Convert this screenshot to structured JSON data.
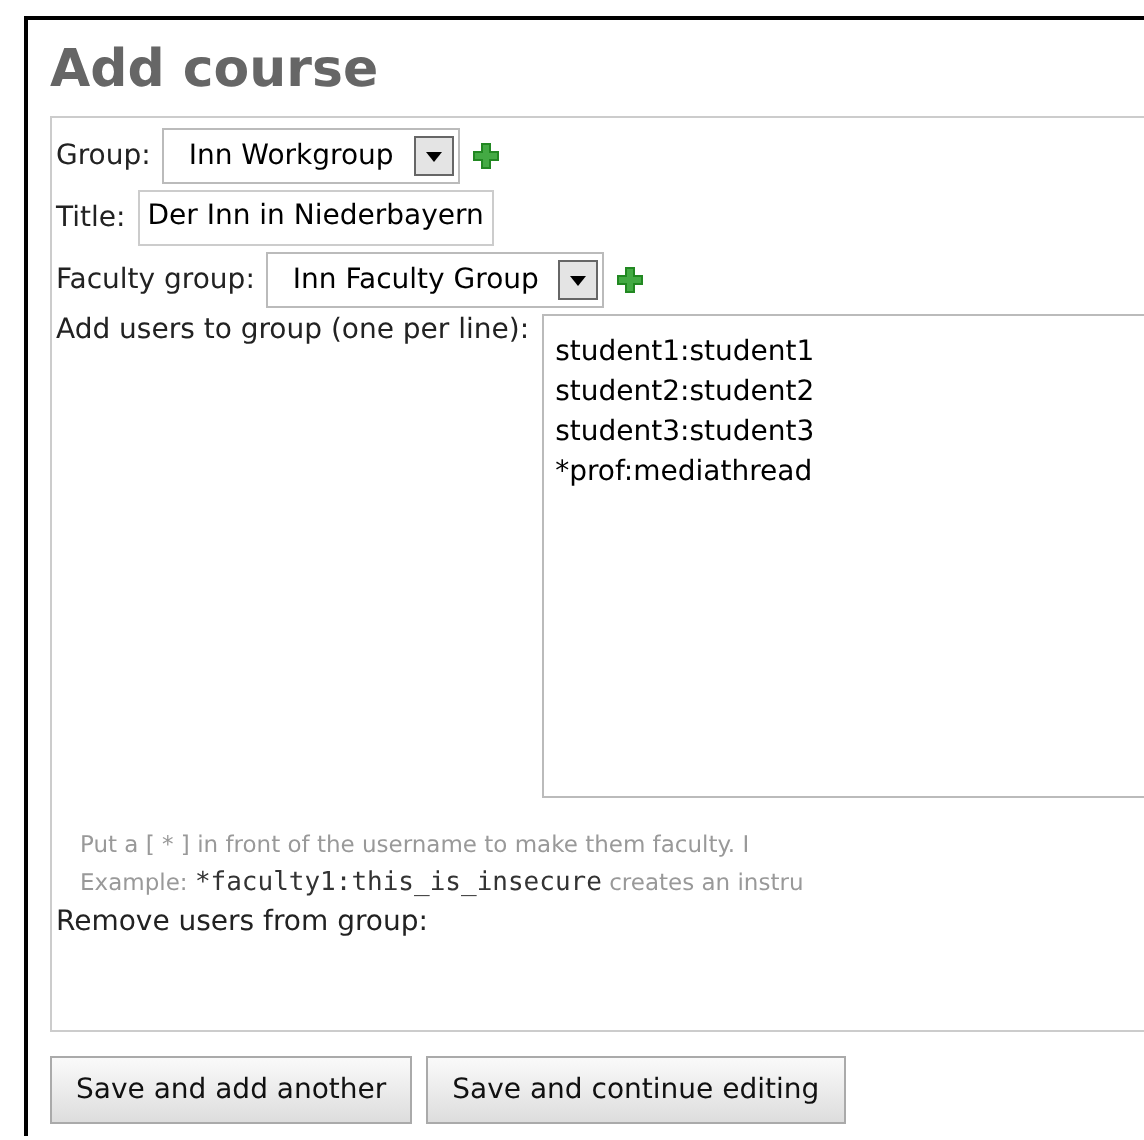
{
  "heading": "Add course",
  "fields": [
    {
      "kind": "select",
      "label": "Group:",
      "value": "Inn Workgroup",
      "add": true
    },
    {
      "kind": "text",
      "label": "Title:",
      "value": "Der Inn in Niederbayern"
    },
    {
      "kind": "select",
      "label": "Faculty group:",
      "value": "Inn Faculty Group",
      "add": true
    }
  ],
  "add_users": {
    "label": "Add users to group (one per line):",
    "lines": [
      "student1:student1",
      "student2:student2",
      "student3:student3",
      "*prof:mediathread"
    ]
  },
  "help": {
    "line": "Put a [ * ] in front of the username to make them faculty. I",
    "example_label": "Example:",
    "example_code": "*faculty1:this_is_insecure",
    "example_rest": "creates an instru"
  },
  "remove_users": {
    "label": "Remove users from group:"
  },
  "buttons": [
    "Save and add another",
    "Save and continue editing"
  ]
}
